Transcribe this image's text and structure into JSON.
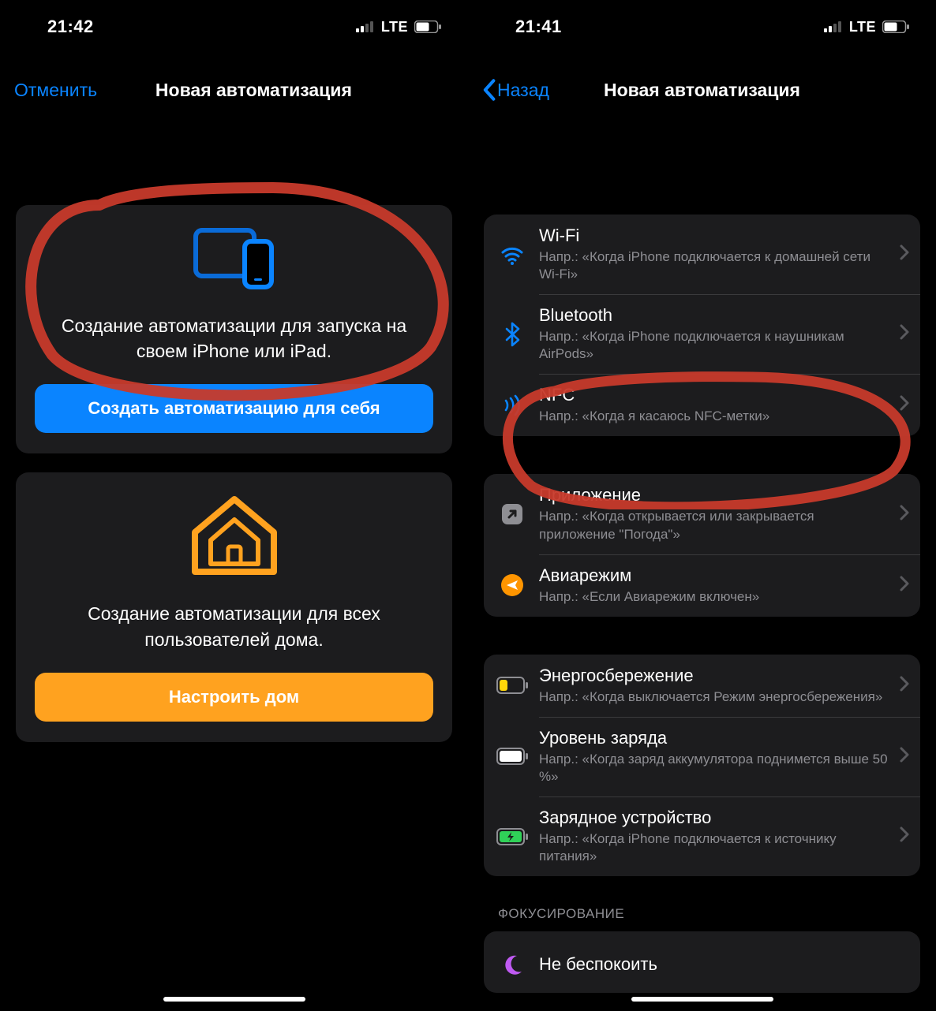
{
  "left": {
    "status": {
      "time": "21:42",
      "carrier": "LTE"
    },
    "nav": {
      "cancel": "Отменить",
      "title": "Новая автоматизация"
    },
    "card_personal": {
      "desc": "Создание автоматизации для запуска на своем iPhone или iPad.",
      "button": "Создать автоматизацию для себя"
    },
    "card_home": {
      "desc": "Создание автоматизации для всех пользователей дома.",
      "button": "Настроить дом"
    }
  },
  "right": {
    "status": {
      "time": "21:41",
      "carrier": "LTE"
    },
    "nav": {
      "back": "Назад",
      "title": "Новая автоматизация"
    },
    "group_net": [
      {
        "title": "Wi-Fi",
        "sub": "Напр.: «Когда iPhone подключается к домашней сети Wi-Fi»"
      },
      {
        "title": "Bluetooth",
        "sub": "Напр.: «Когда iPhone подключается к наушникам AirPods»"
      },
      {
        "title": "NFC",
        "sub": "Напр.: «Когда я касаюсь NFC-метки»"
      }
    ],
    "group_app": [
      {
        "title": "Приложение",
        "sub": "Напр.: «Когда открывается или закрывается приложение \"Погода\"»"
      },
      {
        "title": "Авиарежим",
        "sub": "Напр.: «Если Авиарежим включен»"
      }
    ],
    "group_power": [
      {
        "title": "Энергосбережение",
        "sub": "Напр.: «Когда выключается Режим энергосбережения»"
      },
      {
        "title": "Уровень заряда",
        "sub": "Напр.: «Когда заряд аккумулятора поднимется выше 50 %»"
      },
      {
        "title": "Зарядное устройство",
        "sub": "Напр.: «Когда iPhone подключается к источнику питания»"
      }
    ],
    "header_focus": "ФОКУСИРОВАНИЕ",
    "group_focus": [
      {
        "title": "Не беспокоить",
        "sub": ""
      }
    ]
  }
}
